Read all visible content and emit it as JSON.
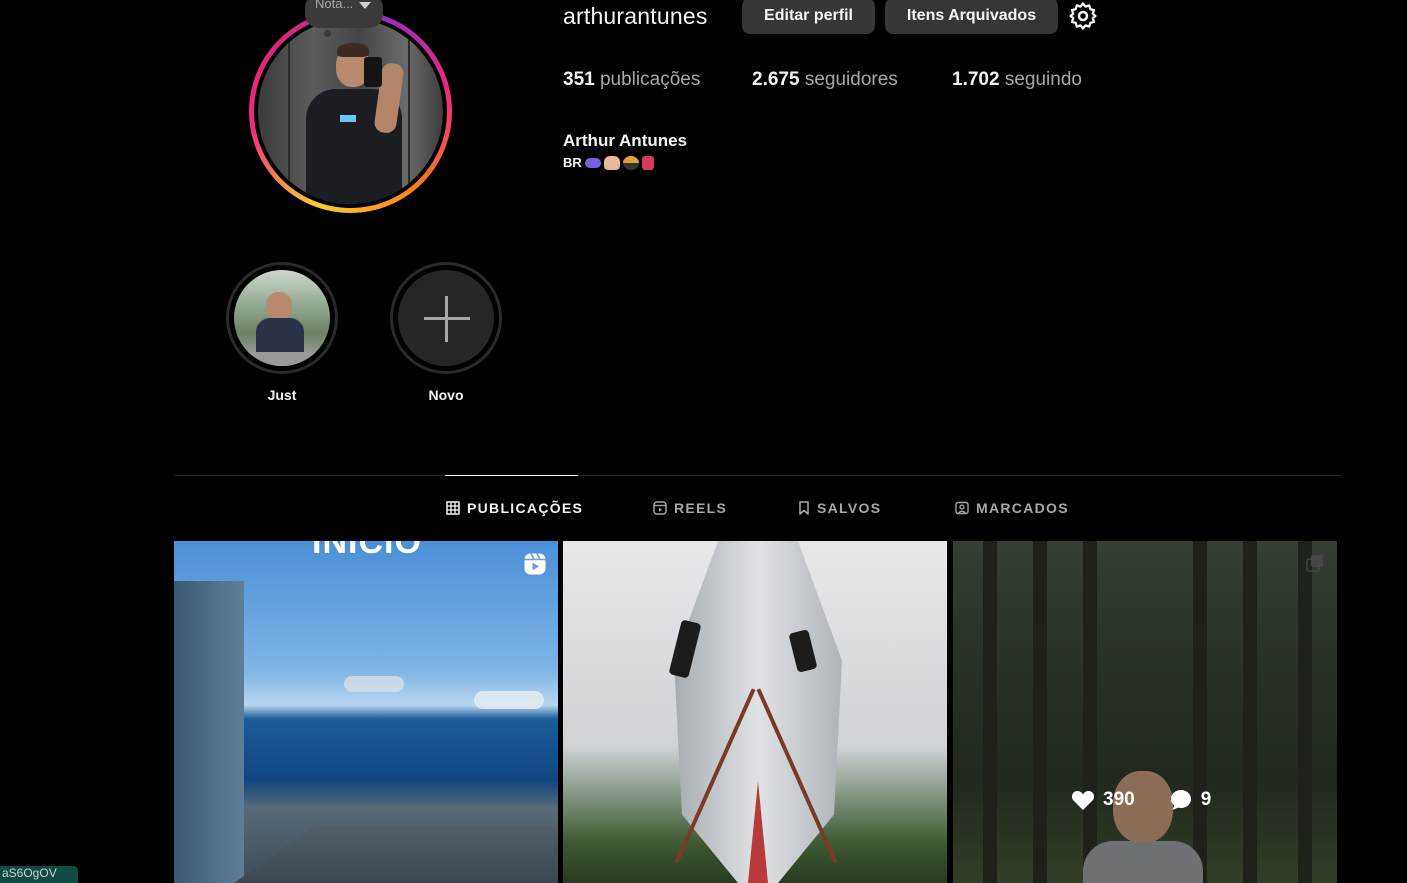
{
  "profile": {
    "username": "arthurantunes",
    "note": "Nota...",
    "edit_button": "Editar perfil",
    "archive_button": "Itens Arquivados",
    "stats": {
      "posts_count": "351",
      "posts_label": "publicações",
      "followers_count": "2.675",
      "followers_label": "seguidores",
      "following_count": "1.702",
      "following_label": "seguindo"
    },
    "full_name": "Arthur Antunes",
    "bio_prefix": "BR",
    "bio_icons": [
      "game-controller-icon",
      "raised-hand-icon",
      "cyclist-icon",
      "book-icon"
    ]
  },
  "highlights": [
    {
      "label": "Just"
    },
    {
      "label": "Novo"
    }
  ],
  "tabs": [
    {
      "label": "PUBLICAÇÕES",
      "icon": "grid-icon",
      "active": true
    },
    {
      "label": "REELS",
      "icon": "reels-icon",
      "active": false
    },
    {
      "label": "SALVOS",
      "icon": "bookmark-icon",
      "active": false
    },
    {
      "label": "MARCADOS",
      "icon": "tagged-icon",
      "active": false
    }
  ],
  "posts": [
    {
      "overlay_text": "INÍCIO",
      "type_icon": "reel-icon"
    },
    {
      "type_icon": ""
    },
    {
      "type_icon": "multi-photo-icon",
      "likes": "390",
      "comments": "9"
    }
  ],
  "status_url": "aS6OgOV",
  "colors": {
    "background": "#000000",
    "button_bg": "#363636",
    "muted_text": "#a8a8a8",
    "story_ring": [
      "#f9ce34",
      "#ee2a7b",
      "#6228d7"
    ]
  }
}
